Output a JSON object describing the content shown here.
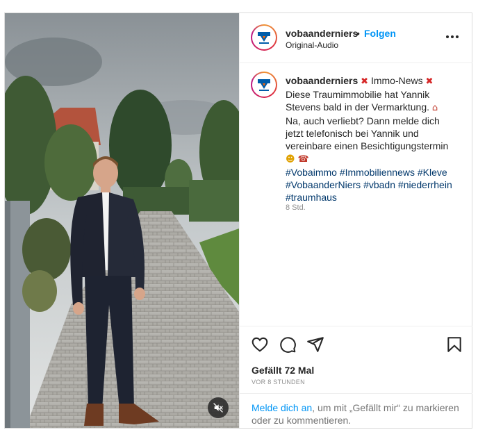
{
  "header": {
    "username": "vobaanderniers",
    "separator": "•",
    "follow_label": "Folgen",
    "audio_label": "Original-Audio"
  },
  "caption": {
    "username": "vobaanderniers",
    "lines": [
      "Immo-News",
      "Diese Traumimmobilie hat Yannik",
      "Stevens bald in der Vermarktung.",
      "Na, auch verliebt? Dann melde dich",
      "jetzt telefonisch bei Yannik und",
      "vereinbare einen Besichtigungstermin"
    ],
    "hashtags": [
      "#Vobaimmo",
      "#Immobiliennews",
      "#Kleve",
      "#VobaanderNiers",
      "#vbadn",
      "#niederrhein",
      "#traumhaus"
    ],
    "time": "8 Std."
  },
  "actions": {
    "like_icon": "heart-icon",
    "comment_icon": "comment-icon",
    "share_icon": "share-icon",
    "save_icon": "bookmark-icon"
  },
  "likes": {
    "text": "Gefällt 72 Mal",
    "ago": "VOR 8 STUNDEN"
  },
  "login_prompt": {
    "link_text": "Melde dich an",
    "rest_text": ", um mit „Gefällt mir“ zu markieren oder zu kommentieren."
  },
  "media": {
    "mute_icon": "speaker-muted-icon"
  },
  "colors": {
    "accent": "#0095f6",
    "hashtag": "#00376b",
    "logo_blue": "#005ca9",
    "logo_orange": "#ff6600"
  }
}
